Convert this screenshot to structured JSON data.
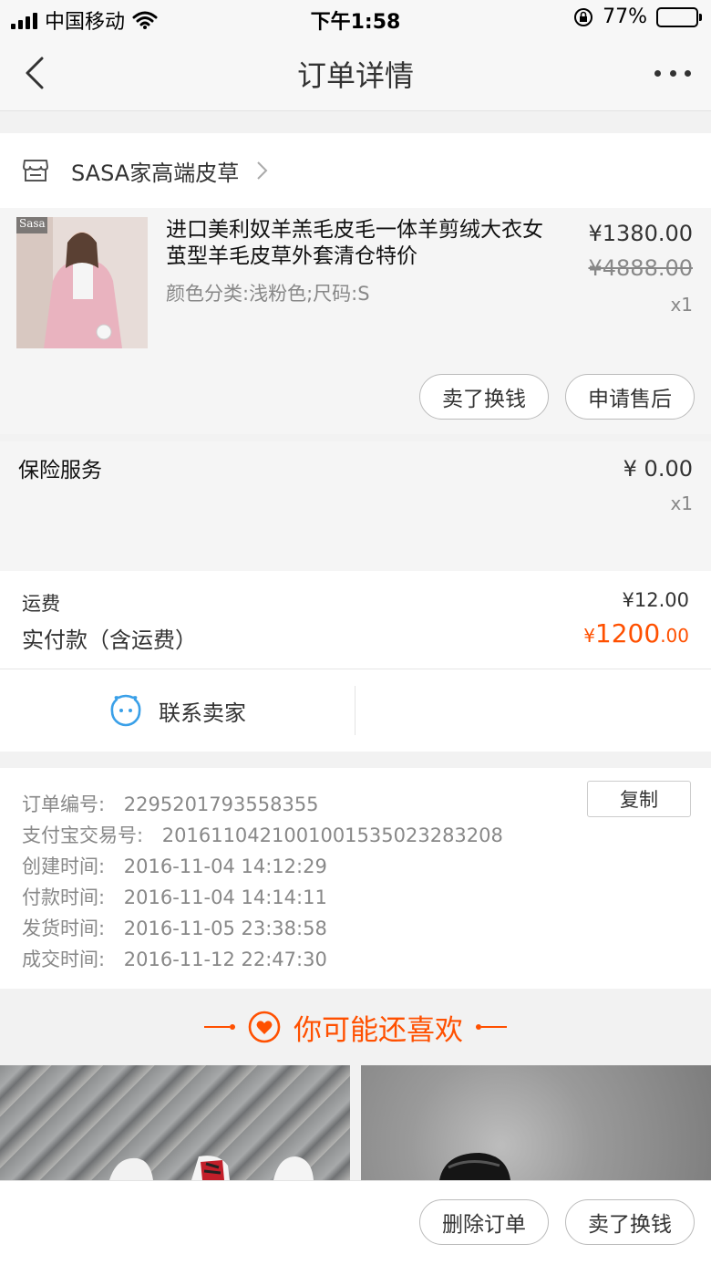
{
  "status": {
    "carrier": "中国移动",
    "time": "下午1:58",
    "battery": "77%",
    "battery_level": 0.77
  },
  "nav": {
    "title": "订单详情"
  },
  "store": {
    "name": "SASA家高端皮草"
  },
  "product": {
    "title": "进口美利奴羊羔毛皮毛一体羊剪绒大衣女茧型羊毛皮草外套清仓特价",
    "sku": "颜色分类:浅粉色;尺码:S",
    "price": "¥1380.00",
    "original_price": "¥4888.00",
    "quantity": "x1",
    "thumb_label": "Sasa",
    "actions": [
      "卖了换钱",
      "申请售后"
    ]
  },
  "insurance": {
    "label": "保险服务",
    "price": "¥ 0.00",
    "quantity": "x1"
  },
  "fees": {
    "shipping_label": "运费",
    "shipping_value": "¥12.00",
    "total_label": "实付款（含运费）",
    "total_currency": "¥",
    "total_int": "1200",
    "total_dec": ".00"
  },
  "contact": {
    "label": "联系卖家"
  },
  "order_info": {
    "copy_label": "复制",
    "rows": [
      {
        "label": "订单编号:",
        "value": "2295201793558355"
      },
      {
        "label": "支付宝交易号:",
        "value": "2016110421001001535023283208"
      },
      {
        "label": "创建时间:",
        "value": "2016-11-04 14:12:29"
      },
      {
        "label": "付款时间:",
        "value": "2016-11-04 14:14:11"
      },
      {
        "label": "发货时间:",
        "value": "2016-11-05 23:38:58"
      },
      {
        "label": "成交时间:",
        "value": "2016-11-12 22:47:30"
      }
    ]
  },
  "recommend": {
    "title": "你可能还喜欢"
  },
  "bottom_actions": [
    "删除订单",
    "卖了换钱"
  ],
  "colors": {
    "accent": "#ff5000",
    "contact_icon": "#3aa0e8"
  }
}
